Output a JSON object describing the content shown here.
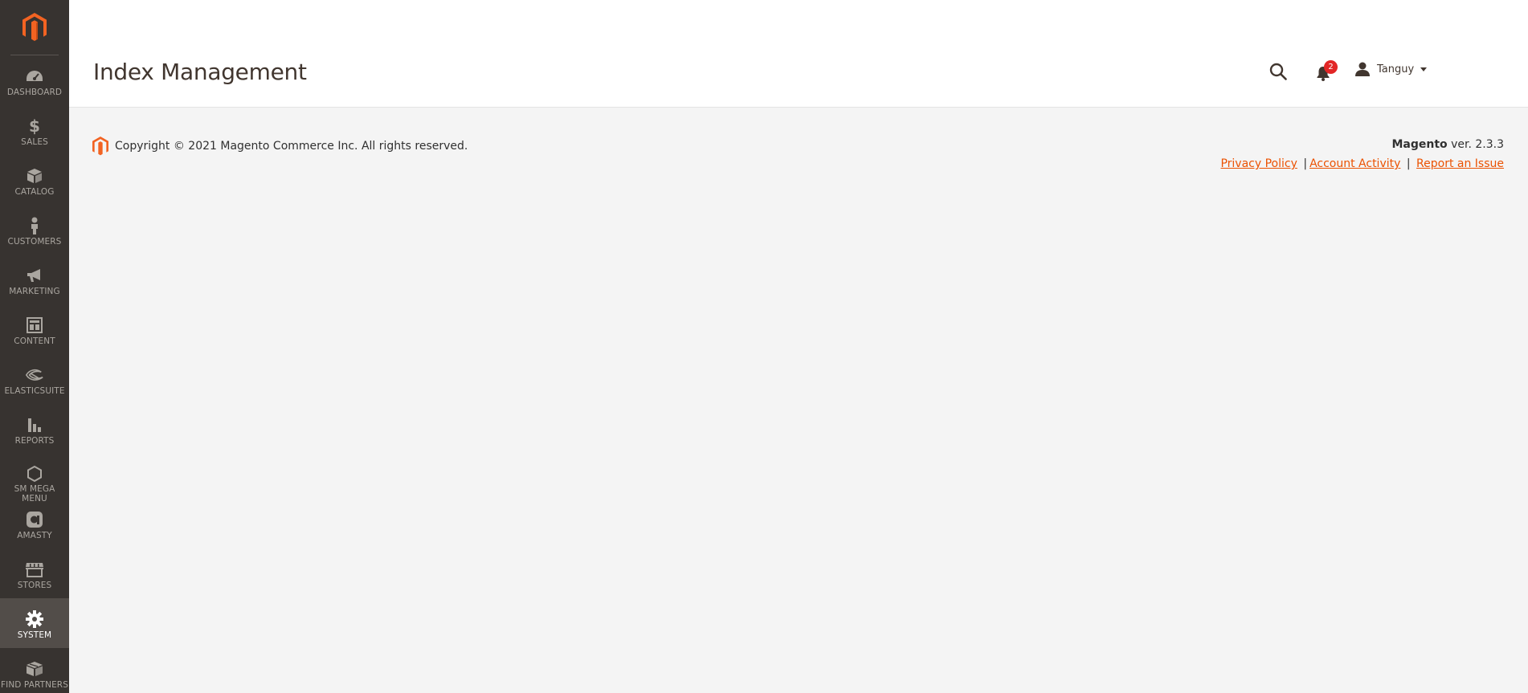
{
  "sidebar": {
    "items": [
      {
        "label": "DASHBOARD",
        "icon": "dashboard-icon"
      },
      {
        "label": "SALES",
        "icon": "dollar-icon"
      },
      {
        "label": "CATALOG",
        "icon": "box-icon"
      },
      {
        "label": "CUSTOMERS",
        "icon": "person-icon"
      },
      {
        "label": "MARKETING",
        "icon": "megaphone-icon"
      },
      {
        "label": "CONTENT",
        "icon": "layout-icon"
      },
      {
        "label": "ELASTICSUITE",
        "icon": "elasticsuite-icon"
      },
      {
        "label": "REPORTS",
        "icon": "bar-chart-icon"
      },
      {
        "label": "SM MEGA MENU",
        "icon": "hexagon-icon"
      },
      {
        "label": "AMASTY",
        "icon": "amasty-icon"
      },
      {
        "label": "STORES",
        "icon": "store-icon"
      },
      {
        "label": "SYSTEM",
        "icon": "gear-icon"
      },
      {
        "label": "FIND PARTNERS",
        "icon": "partners-box-icon"
      }
    ],
    "active": "SYSTEM"
  },
  "header": {
    "title": "Index Management",
    "notifications_count": "2",
    "user_name": "Tanguy"
  },
  "footer": {
    "copyright": "Copyright © 2021 Magento Commerce Inc. All rights reserved.",
    "brand": "Magento",
    "version": " ver. 2.3.3",
    "links": {
      "privacy": "Privacy Policy",
      "activity": "Account Activity",
      "report": "Report an Issue"
    },
    "separator": "|"
  },
  "colors": {
    "sidebar_bg": "#373330",
    "sidebar_active": "#524d49",
    "accent": "#eb5202",
    "badge": "#e22626",
    "page_bg": "#f4f4f4"
  }
}
